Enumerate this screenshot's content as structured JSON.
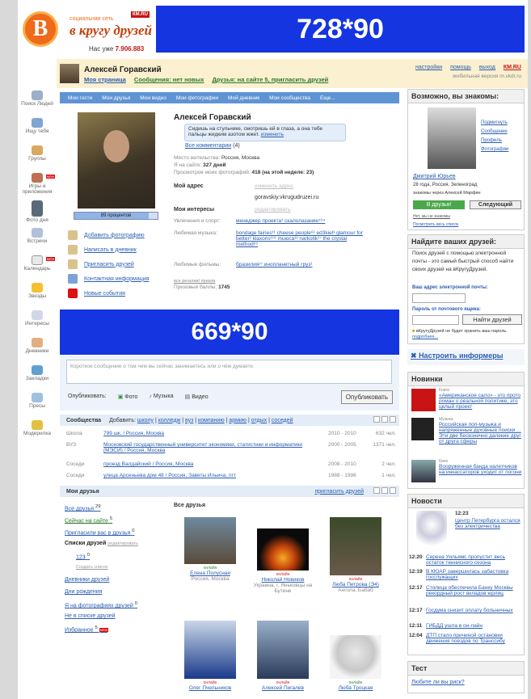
{
  "banner_top": "728*90",
  "banner_mid": "669*90",
  "brand": {
    "logo_letter": "В",
    "small": "социальная сеть",
    "name": "в кругу друзей",
    "km": "КМ.RU",
    "count_prefix": "Нас уже",
    "count": "7.906.883"
  },
  "user": {
    "name": "Алексей Горавский",
    "nav": [
      "Моя страница",
      "Сообщения: нет новых",
      "Друзья: на сайте 5, пригласить друзей"
    ],
    "links": [
      "настройки",
      "помощь",
      "выход",
      "КМ.RU"
    ],
    "mobile": "мобильная версия m.vkdr.ru"
  },
  "left_nav": [
    {
      "label": "Поиск Людей"
    },
    {
      "label": "Ищу тебя"
    },
    {
      "label": "Группы"
    },
    {
      "label": "Игры и приложения"
    },
    {
      "label": "Фото дня"
    },
    {
      "label": "Встречи"
    },
    {
      "label": "Календарь"
    },
    {
      "label": "Звезды"
    },
    {
      "label": "Интересы"
    },
    {
      "label": "Дневники"
    },
    {
      "label": "Закладки"
    },
    {
      "label": "Пресы"
    },
    {
      "label": "Модерилка"
    }
  ],
  "tabs": [
    "Мои гости",
    "Мои друзья",
    "Мои видео",
    "Мои фотографии",
    "Мой дневник",
    "Мои сообщества",
    "Еще..."
  ],
  "profile": {
    "name": "Алексей Горавский",
    "status": "Сидишь на стульчике, смотришь ей в глаза, а она тебе пальцы жидким азотом жжет.",
    "status_edit": "изменить",
    "comments": "Все комментарии",
    "comments_count": "(4)",
    "residence_label": "Место жительства:",
    "residence": "Россия, Москва",
    "onsite_label": "Я на сайте:",
    "onsite": "327 дней",
    "views_label": "Просмотров моих фотографий:",
    "views": "418 (на этой неделе: 23)",
    "address_h": "Мой адрес",
    "address_edit": "изменить адрес",
    "address": "goravskiy.vkrugudruzei.ru",
    "interests_h": "Мои интересы",
    "interests_edit": "редактировать",
    "hobby_label": "Увлечения и спорт:",
    "hobby": "менеджер проекта¹ скалолазание⁵⁹⁴",
    "music_label": "Любимая музыка:",
    "music": "bondage fairies¹¹ cheese people⁶² ed3kiel³ glamour for better³ klaxons¹¹⁸ muюса³³ narkotik¹⁷ the crystal method⁸⁵",
    "films_label": "Любимые фильмы:",
    "films": "бразилия²⁷ инопланетный груз¹",
    "all_regalia": "все регалии/ призов",
    "prize_label": "Призовые баллы:",
    "prize": "1745",
    "progress_label": "89 процентов",
    "progress_pct": 89
  },
  "actions": [
    "Добавить фотографию",
    "Написать в дневник",
    "Пригласить друзей",
    "Контактная информация",
    "Новые события"
  ],
  "wall": {
    "placeholder": "Короткое сообщение о том чем вы сейчас занимаетесь или о чём думаете.",
    "publish_label": "Опубликовать:",
    "photo": "Фото",
    "music": "Музыка",
    "video": "Видео",
    "button": "Опубликовать"
  },
  "communities": {
    "title": "Сообщества",
    "add": "Добавить:",
    "add_links": [
      "школу",
      "колледж",
      "вуз",
      "компанию",
      "армию",
      "отдых",
      "соседей"
    ],
    "rows": [
      {
        "type": "Школа",
        "name": "799 шк. / Россия, Москва",
        "years": "2010 - 2010",
        "count": "632 чел."
      },
      {
        "type": "ВУЗ",
        "name": "Московский государственный университет экономики, статистики и информатики (МЭСИ) / Россия, Москва",
        "years": "2000 - 2005",
        "count": "1371 чел."
      },
      {
        "type": "Соседи",
        "name": "проезд Валдайский / Россия, Москва",
        "years": "2008 - 2010",
        "count": "2 чел."
      },
      {
        "type": "Соседи",
        "name": "улица Арсеньева дом 48 / Россия, Заветы Ильича, пгт",
        "years": "1988 - 1996",
        "count": "1 чел."
      }
    ]
  },
  "friends": {
    "title": "Мои друзья",
    "invite": "пригласить друзей",
    "left": [
      {
        "label": "Все друзья",
        "count": "29"
      },
      {
        "label": "Сейчас на сайте",
        "count": "5"
      },
      {
        "label": "Пригласили вас в друзья",
        "count": "0"
      },
      {
        "label": "Списки друзей",
        "count": "редактировать"
      },
      {
        "label": "123",
        "count": "0"
      },
      {
        "label": "Создать список",
        "count": ""
      },
      {
        "label": "Дневники друзей",
        "count": ""
      },
      {
        "label": "Дни рождения",
        "count": ""
      },
      {
        "label": "Я на фотографиях друзей",
        "count": "0"
      },
      {
        "label": "Не в списке друзей",
        "count": ""
      },
      {
        "label": "Избранное",
        "count": "5"
      }
    ],
    "all_h": "Все друзья",
    "online_label": "онлайн",
    "cards": [
      {
        "name": "Елена Полусная",
        "loc": "Россия, Москва"
      },
      {
        "name": "Николай Новиков",
        "loc": "Украина, г. Яньковцы на Бутене"
      },
      {
        "name": "Люба Петрова (Э4)",
        "loc": "Ангола, Бабаб"
      },
      {
        "name": "Олег Пчельников",
        "loc": ""
      },
      {
        "name": "Алексей Пигалев",
        "loc": ""
      },
      {
        "name": "Люба Троцкая",
        "loc": ""
      }
    ]
  },
  "right": {
    "maybe_h": "Возможно, вы знакомы:",
    "maybe_links": [
      "Подмигнуть",
      "Сообщение",
      "Профиль",
      "Фотографии"
    ],
    "maybe_name": "Дмитрий Юрьев",
    "maybe_info": "28 года, Россия, Зеленоград",
    "maybe_via": "знакомы через Алексей Марфин",
    "add_btn": "В друзья!",
    "next_btn": "Следующий",
    "no_thanks": "Нет, мы не знакомы",
    "see_all": "Посмотреть весь список",
    "find_h": "Найдите ваших друзей:",
    "find_text": "Поиск друзей с помощью электронной почты - это самый быстрый способ найти своих друзей на вКругуДрузей.",
    "email_label": "Ваш адрес электронной почты:",
    "pass_label": "Пароль от почтового ящика:",
    "find_btn": "Найти друзей",
    "find_note": "вКругуДрузей не будет хранить ваш пароль.",
    "find_more": "подробнее...",
    "informers": "Настроить информеры",
    "novinki_h": "Новинки",
    "novinki": [
      {
        "cat": "Книги",
        "text": "«Американское сало» - это прото роман о реальной политике, это целый проект"
      },
      {
        "cat": "Музыка",
        "text": "Российская поп-музыка и напряженные духовные поиски ... Эти две бесконечно далекие друг от друга сферы"
      },
      {
        "cat": "Кино",
        "text": "Вооруженная банда налетчиков на инкассаторов уходит от погони"
      }
    ],
    "news_h": "Новости",
    "news_top_time": "12:23",
    "news_top": "Центр Петербурга остался без электричества",
    "news": [
      {
        "t": "12:20",
        "text": "Серена Уильямс пропустит весь остаток теннисного сезона"
      },
      {
        "t": "12:19",
        "text": "В КЮАР завершилась забастовка госслужащих"
      },
      {
        "t": "12:17",
        "text": "Столица обеспечила Банку Москвы рекордный рост вкладов юрлиц"
      },
      {
        "t": "12:17",
        "text": "Госдума снизит оплату больничных"
      },
      {
        "t": "12:11",
        "text": "ГИБДД ушла в он-лайн"
      },
      {
        "t": "12:04",
        "text": "ДТП стало причиной остановки движения поездов по Транссибу"
      }
    ],
    "test_h": "Тест",
    "test_q": "Любите ли вы риск?"
  }
}
